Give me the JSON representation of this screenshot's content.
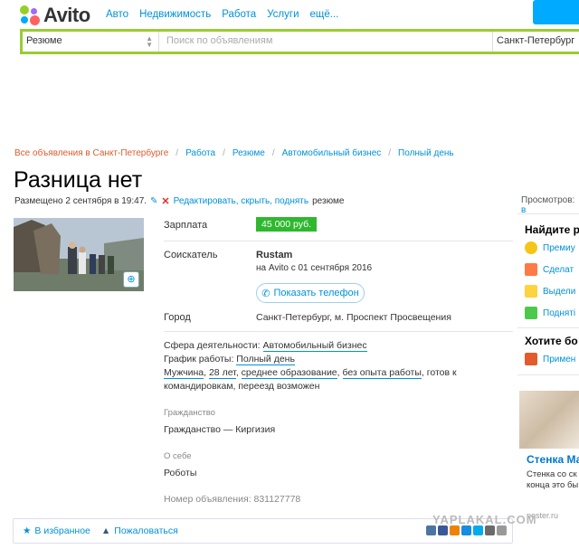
{
  "header": {
    "logo_text": "Avito",
    "nav": [
      "Авто",
      "Недвижимость",
      "Работа",
      "Услуги",
      "ещё..."
    ]
  },
  "search": {
    "category": "Резюме",
    "placeholder": "Поиск по объявлениям",
    "city": "Санкт-Петербург"
  },
  "breadcrumbs": [
    "Все объявления в Санкт-Петербурге",
    "Работа",
    "Резюме",
    "Автомобильный бизнес",
    "Полный день"
  ],
  "listing": {
    "title": "Разница нет",
    "posted": "Размещено 2 сентября в 19:47.",
    "edit_link": "Редактировать, скрыть, поднять",
    "edit_suffix": "резюме",
    "views_label": "Просмотров:",
    "views_value": "в"
  },
  "details": {
    "salary_label": "Зарплата",
    "salary_value": "45 000 руб.",
    "seeker_label": "Соискатель",
    "seeker_name": "Rustam",
    "seeker_since": "на Avito с 01 сентября 2016",
    "phone_button": "Показать телефон",
    "city_label": "Город",
    "city_value": "Санкт-Петербург, м. Проспект Просвещения"
  },
  "description": {
    "field_label": "Сфера деятельности:",
    "field_value": "Автомобильный бизнес",
    "schedule_label": "График работы:",
    "schedule_value": "Полный день",
    "gender": "Мужчина",
    "age": "28 лет",
    "education": "среднее образование",
    "experience": "без опыта работы",
    "rest": ", готов к командировкам, переезд возможен"
  },
  "citizenship": {
    "heading": "Гражданство",
    "value": "Гражданство — Киргизия"
  },
  "about": {
    "heading": "О себе",
    "value": "Роботы"
  },
  "ad_number": "Номер объявления: 831127778",
  "footer": {
    "favorite": "В избранное",
    "complain": "Пожаловаться"
  },
  "sidebar": {
    "promo_heading": "Найдите р",
    "promo_items": [
      "Премиу",
      "Сделат",
      "Выдели",
      "Подняті"
    ],
    "want_heading": "Хотите бо",
    "want_item": "Примен",
    "ad_title": "Стенка Ма",
    "ad_text_1": "Стенка со ск",
    "ad_text_2": "конца это бы",
    "ad_domain": "pester.ru"
  },
  "watermark": "YAPLAKAL.COM",
  "colors": {
    "accent": "#0091d9",
    "brand_green": "#99cc33",
    "price_green": "#2eb82e",
    "breadcrumb_first": "#e05a2b"
  }
}
